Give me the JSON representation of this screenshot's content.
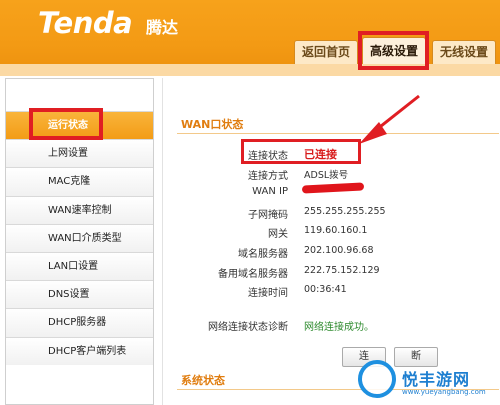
{
  "header": {
    "logo": "Tenda",
    "logo_cn": "腾达",
    "tabs": [
      {
        "label": "返回首页",
        "selected": false
      },
      {
        "label": "高级设置",
        "selected": true
      },
      {
        "label": "无线设置",
        "selected": false
      }
    ]
  },
  "sidebar": {
    "items": [
      {
        "label": "运行状态",
        "active": true
      },
      {
        "label": "上网设置"
      },
      {
        "label": "MAC克隆"
      },
      {
        "label": "WAN速率控制"
      },
      {
        "label": "WAN口介质类型"
      },
      {
        "label": "LAN口设置"
      },
      {
        "label": "DNS设置"
      },
      {
        "label": "DHCP服务器"
      },
      {
        "label": "DHCP客户端列表"
      }
    ]
  },
  "wan_status": {
    "title": "WAN口状态",
    "rows": [
      {
        "label": "连接状态",
        "value": "已连接"
      },
      {
        "label": "连接方式",
        "value": "ADSL拨号"
      },
      {
        "label": "WAN IP",
        "value": ""
      },
      {
        "label": "子网掩码",
        "value": "255.255.255.255"
      },
      {
        "label": "网关",
        "value": "119.60.160.1"
      },
      {
        "label": "域名服务器",
        "value": "202.100.96.68"
      },
      {
        "label": "备用域名服务器",
        "value": "222.75.152.129"
      },
      {
        "label": "连接时间",
        "value": "00:36:41"
      }
    ],
    "diagnosis_label": "网络连接状态诊断",
    "diagnosis_value": "网络连接成功。"
  },
  "buttons": {
    "connect": "连",
    "disconnect": "断"
  },
  "system_status": {
    "title": "系统状态"
  },
  "watermark": {
    "text": "悦丰游网",
    "url": "www.yueyangbang.com"
  },
  "colors": {
    "brand_orange": "#f39a14",
    "highlight_red": "#e01e23",
    "status_red": "#d81c1c",
    "success_green": "#2d8a2d"
  }
}
